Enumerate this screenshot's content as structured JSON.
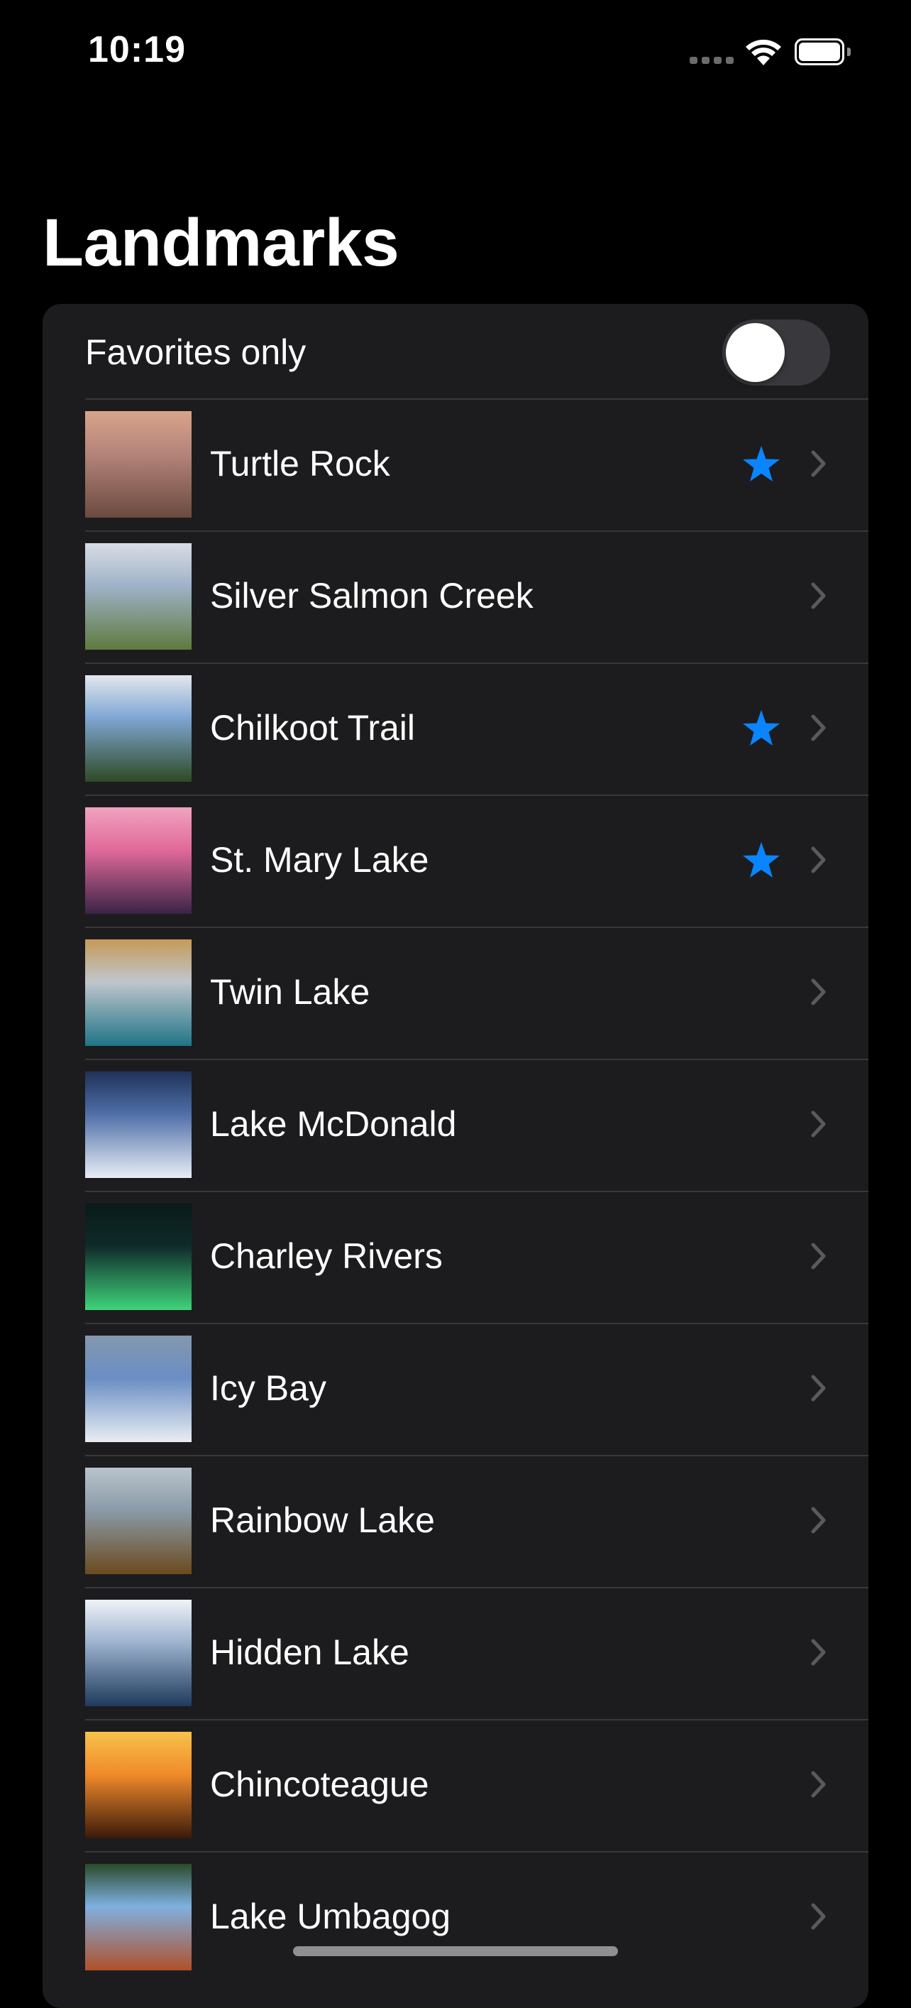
{
  "status_bar": {
    "time": "10:19"
  },
  "title": "Landmarks",
  "favorites_toggle": {
    "label": "Favorites only",
    "on": false
  },
  "colors": {
    "accent": "#0a84ff",
    "background": "#000000",
    "card": "#1c1c1e",
    "separator": "#38383a",
    "chevron": "#5a5a5e"
  },
  "landmarks": [
    {
      "name": "Turtle Rock",
      "favorite": true,
      "thumb": [
        "#b4847a",
        "#6b4a40",
        "#d8a48a"
      ]
    },
    {
      "name": "Silver Salmon Creek",
      "favorite": false,
      "thumb": [
        "#9fb2c8",
        "#5f7a3e",
        "#d9dde5"
      ]
    },
    {
      "name": "Chilkoot Trail",
      "favorite": true,
      "thumb": [
        "#7fa6d3",
        "#2f4a24",
        "#e3e7ee"
      ]
    },
    {
      "name": "St. Mary Lake",
      "favorite": true,
      "thumb": [
        "#e06a9a",
        "#3a2346",
        "#f1a2c0"
      ]
    },
    {
      "name": "Twin Lake",
      "favorite": false,
      "thumb": [
        "#bfc6cc",
        "#1f7487",
        "#c59a58"
      ]
    },
    {
      "name": "Lake McDonald",
      "favorite": false,
      "thumb": [
        "#4f6fa8",
        "#e8edf5",
        "#1f3157"
      ]
    },
    {
      "name": "Charley Rivers",
      "favorite": false,
      "thumb": [
        "#0f2a2a",
        "#3fd47a",
        "#0a1a18"
      ]
    },
    {
      "name": "Icy Bay",
      "favorite": false,
      "thumb": [
        "#6a8ec4",
        "#e9edf3",
        "#8497ae"
      ]
    },
    {
      "name": "Rainbow Lake",
      "favorite": false,
      "thumb": [
        "#8a9aa8",
        "#6b4a1f",
        "#b9c4cc"
      ]
    },
    {
      "name": "Hidden Lake",
      "favorite": false,
      "thumb": [
        "#9db3cf",
        "#1f3a5c",
        "#f0f3f7"
      ]
    },
    {
      "name": "Chincoteague",
      "favorite": false,
      "thumb": [
        "#f08a2a",
        "#3a1a0a",
        "#f6c24a"
      ]
    },
    {
      "name": "Lake Umbagog",
      "favorite": false,
      "thumb": [
        "#7fb0e0",
        "#b0502a",
        "#2a4a2a"
      ]
    }
  ]
}
